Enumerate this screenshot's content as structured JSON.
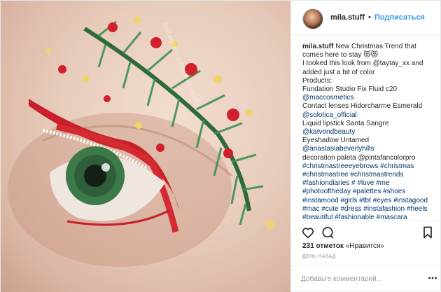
{
  "post": {
    "username": "mila.stuff",
    "separator": "•",
    "follow_label": "Подписаться",
    "caption_lines": [
      "New Christmas Trend that",
      "comes here to stay 😻😻",
      "I tooked this look from @taytay_xx and",
      "added just a bit of color",
      "Products:",
      "Fundation Studio Fix Fluid c20",
      "@maccosmetics",
      "Contact lenses Hidorcharme Esmerald",
      "@solotica_official",
      "Liquid lipstick Santa Sangre",
      "@katvondbeauty",
      "Eyeshadow Untamed",
      "@anastasiabeverlyhills",
      "decoration paleta @pintafancolorpro",
      "#christmastreeeyebrows #christmas",
      "#christmastree #christmastrends",
      "#fashiondiaries # #love #me",
      "#photooftheday #palettes #shoes",
      "#instamood #girls #tbt #eyes #instagood",
      "#mac #cute #dress #instafashion #heels",
      "#beautiful #fashionable #mascara"
    ],
    "likes_count": "231 отметок",
    "likes_suffix": "«Нравится»",
    "time_ago": "ДЕНЬ НАЗАД",
    "comment_placeholder": "Добавьте комментарий...",
    "icons": {
      "like": "heart-icon",
      "comment": "comment-icon",
      "save": "bookmark-icon",
      "more": "more-dots-icon"
    },
    "colors": {
      "link": "#3897f0",
      "text": "#262626",
      "muted": "#999999"
    }
  },
  "photo": {
    "watermark": "instagram.com/mila.stuff"
  }
}
